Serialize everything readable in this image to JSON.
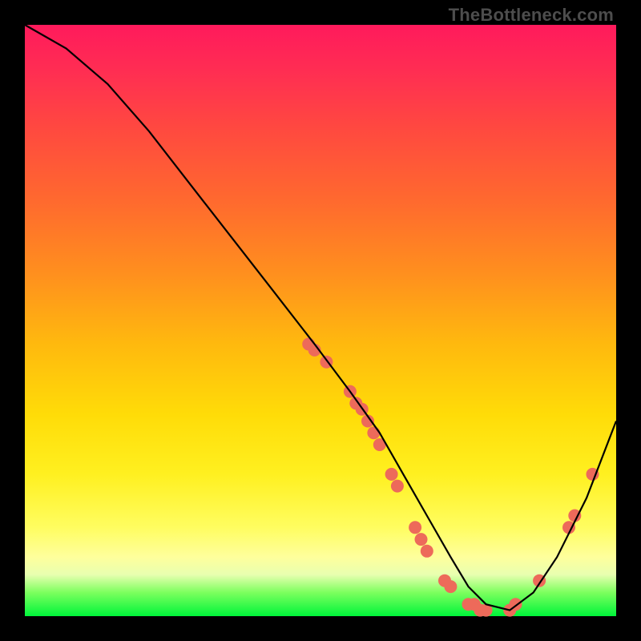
{
  "watermark": "TheBottleneck.com",
  "chart_data": {
    "type": "line",
    "title": "",
    "xlabel": "",
    "ylabel": "",
    "xlim": [
      0,
      100
    ],
    "ylim": [
      0,
      100
    ],
    "series": [
      {
        "name": "curve",
        "x": [
          0,
          7,
          14,
          21,
          28,
          35,
          42,
          49,
          55,
          60,
          64,
          68,
          72,
          75,
          78,
          82,
          86,
          90,
          95,
          100
        ],
        "y": [
          100,
          96,
          90,
          82,
          73,
          64,
          55,
          46,
          38,
          31,
          24,
          17,
          10,
          5,
          2,
          1,
          4,
          10,
          20,
          33
        ]
      }
    ],
    "markers": {
      "name": "thick-dots",
      "color": "#ed6a5a",
      "points": [
        {
          "x": 48,
          "y": 46
        },
        {
          "x": 49,
          "y": 45
        },
        {
          "x": 51,
          "y": 43
        },
        {
          "x": 55,
          "y": 38
        },
        {
          "x": 56,
          "y": 36
        },
        {
          "x": 57,
          "y": 35
        },
        {
          "x": 58,
          "y": 33
        },
        {
          "x": 59,
          "y": 31
        },
        {
          "x": 60,
          "y": 29
        },
        {
          "x": 62,
          "y": 24
        },
        {
          "x": 63,
          "y": 22
        },
        {
          "x": 66,
          "y": 15
        },
        {
          "x": 67,
          "y": 13
        },
        {
          "x": 68,
          "y": 11
        },
        {
          "x": 71,
          "y": 6
        },
        {
          "x": 72,
          "y": 5
        },
        {
          "x": 75,
          "y": 2
        },
        {
          "x": 76,
          "y": 2
        },
        {
          "x": 77,
          "y": 1
        },
        {
          "x": 78,
          "y": 1
        },
        {
          "x": 82,
          "y": 1
        },
        {
          "x": 83,
          "y": 2
        },
        {
          "x": 87,
          "y": 6
        },
        {
          "x": 92,
          "y": 15
        },
        {
          "x": 93,
          "y": 17
        },
        {
          "x": 96,
          "y": 24
        }
      ]
    }
  }
}
